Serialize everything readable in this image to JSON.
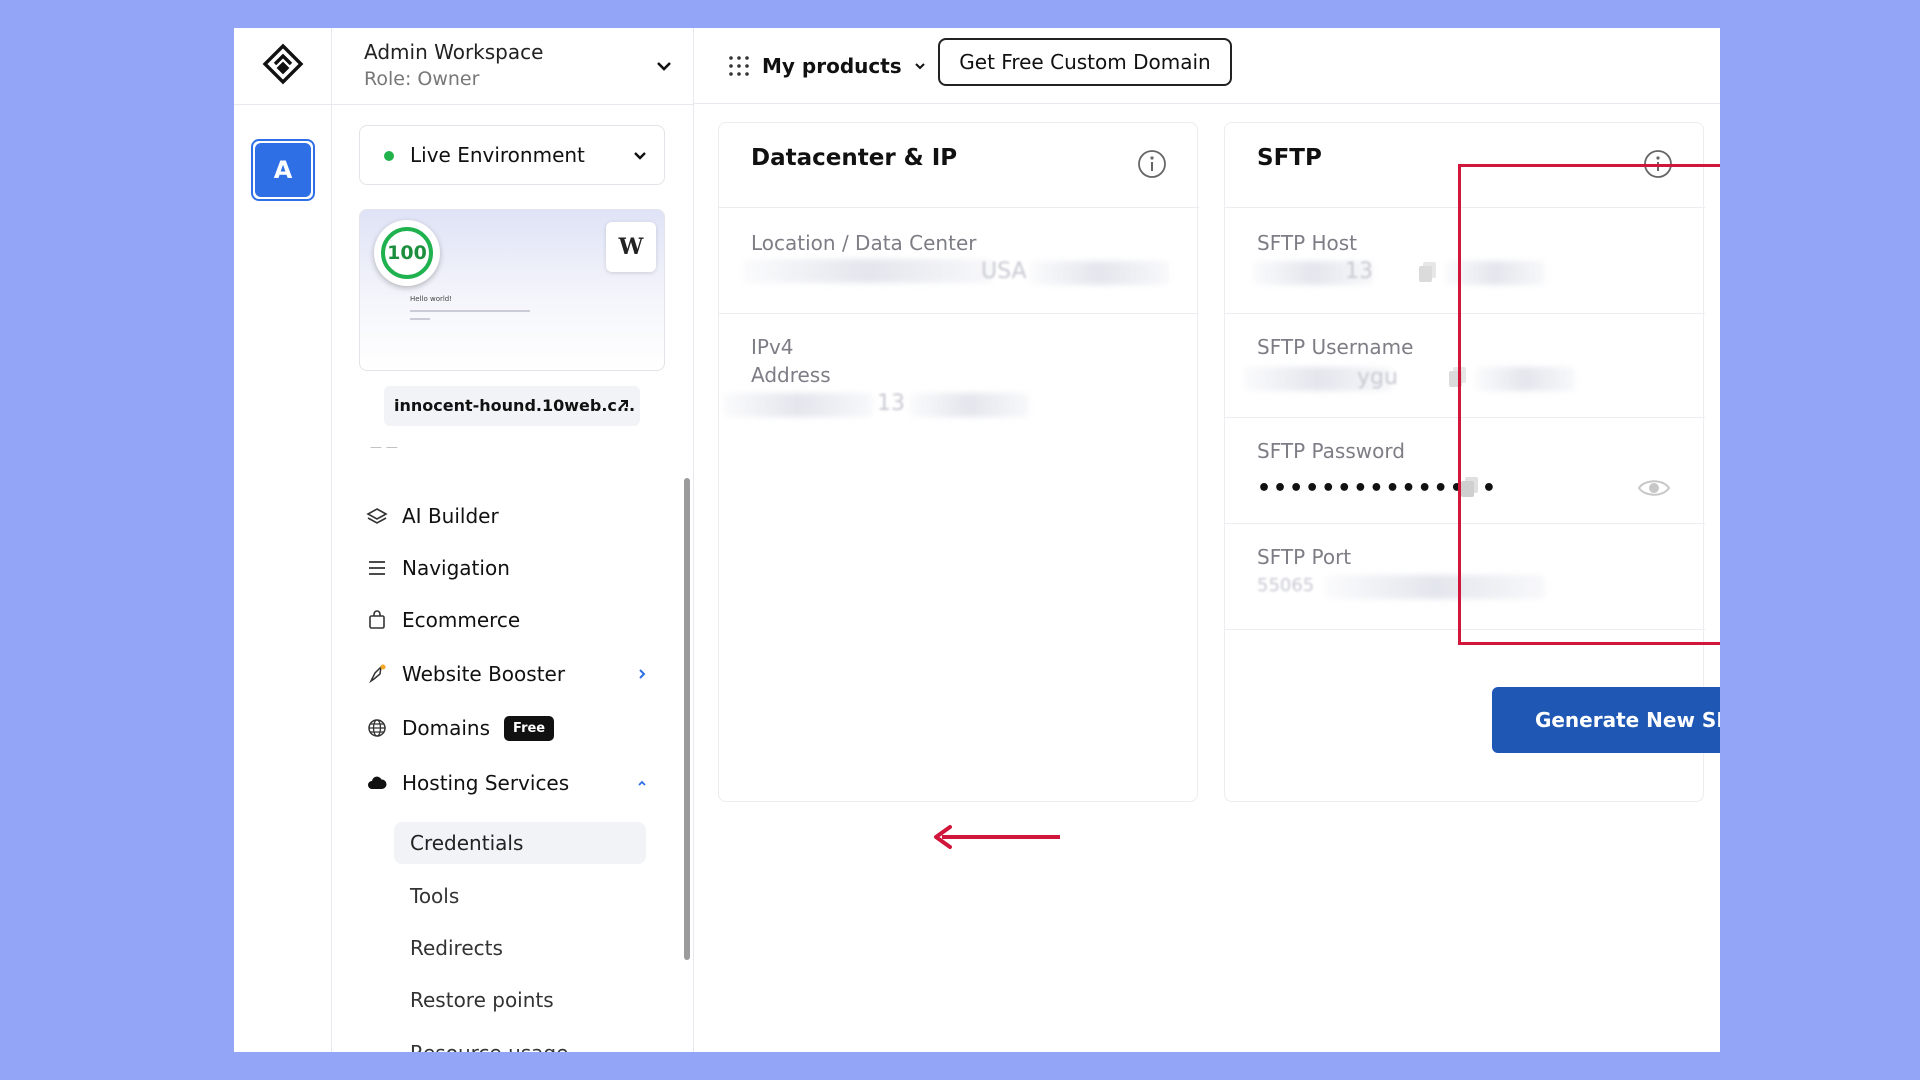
{
  "workspace": {
    "name": "Admin Workspace",
    "role": "Role: Owner"
  },
  "avatar": {
    "letter": "A"
  },
  "environment": {
    "label": "Live Environment"
  },
  "preview": {
    "score": "100",
    "wp_label": "W",
    "site_title": "Hello world!"
  },
  "site_url": "innocent-hound.10web.c...",
  "nav": {
    "items": [
      {
        "label": "AI Builder",
        "icon": "layers-icon"
      },
      {
        "label": "Navigation",
        "icon": "menu-icon"
      },
      {
        "label": "Ecommerce",
        "icon": "shopping-bag-icon"
      },
      {
        "label": "Website Booster",
        "icon": "rocket-icon"
      },
      {
        "label": "Domains",
        "icon": "globe-icon",
        "badge": "Free"
      },
      {
        "label": "Hosting Services",
        "icon": "cloud-icon"
      }
    ],
    "hosting_sub": [
      {
        "label": "Credentials",
        "active": true
      },
      {
        "label": "Tools"
      },
      {
        "label": "Redirects"
      },
      {
        "label": "Restore points"
      },
      {
        "label": "Resource usage"
      }
    ]
  },
  "topbar": {
    "products_label": "My products",
    "domain_button": "Get Free Custom Domain"
  },
  "datacenter": {
    "title": "Datacenter & IP",
    "location_label": "Location / Data Center",
    "location_value_partial": "USA",
    "ipv4_label_line1": "IPv4",
    "ipv4_label_line2": "Address",
    "ipv4_value_partial": "13"
  },
  "sftp": {
    "title": "SFTP",
    "host_label": "SFTP Host",
    "host_value_partial": "13",
    "username_label": "SFTP Username",
    "username_value_partial": "ygu",
    "password_label": "SFTP Password",
    "password_value": "•••••••••••••••",
    "port_label": "SFTP Port",
    "port_value_partial": "55065",
    "generate_button": "Generate New SFTP Password"
  },
  "colors": {
    "background": "#93a5f7",
    "primary_button": "#1f57b4",
    "highlight": "#d0163a",
    "status_green": "#22b24c",
    "avatar": "#2f6fe6"
  }
}
